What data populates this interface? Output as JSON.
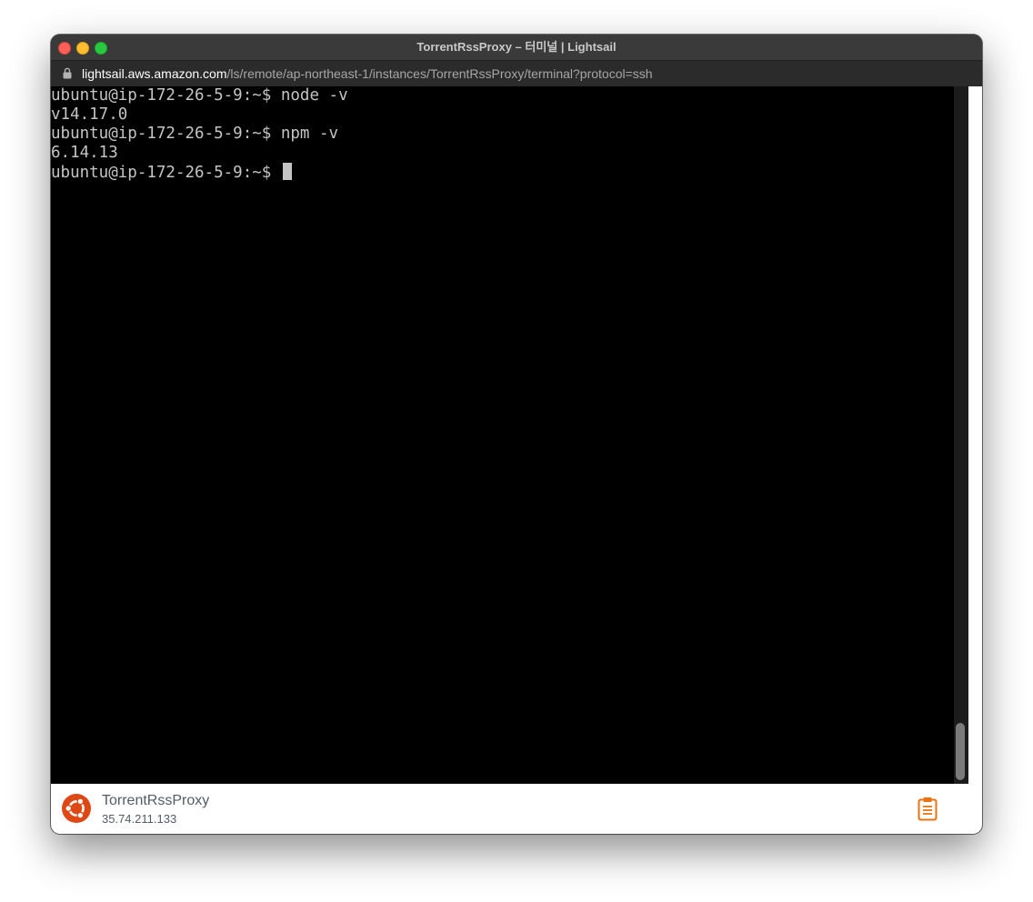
{
  "window": {
    "title": "TorrentRssProxy – 터미널 | Lightsail"
  },
  "url": {
    "host": "lightsail.aws.amazon.com",
    "path": "/ls/remote/ap-northeast-1/instances/TorrentRssProxy/terminal?protocol=ssh"
  },
  "terminal": {
    "lines": [
      "ubuntu@ip-172-26-5-9:~$ node -v",
      "v14.17.0",
      "ubuntu@ip-172-26-5-9:~$ npm -v",
      "6.14.13",
      "ubuntu@ip-172-26-5-9:~$ "
    ]
  },
  "footer": {
    "instance_name": "TorrentRssProxy",
    "ip_address": "35.74.211.133",
    "os_icon": "ubuntu-icon",
    "action_icon": "clipboard-icon"
  },
  "colors": {
    "ubuntu_orange": "#dd4814",
    "clipboard_orange": "#ec7211"
  }
}
